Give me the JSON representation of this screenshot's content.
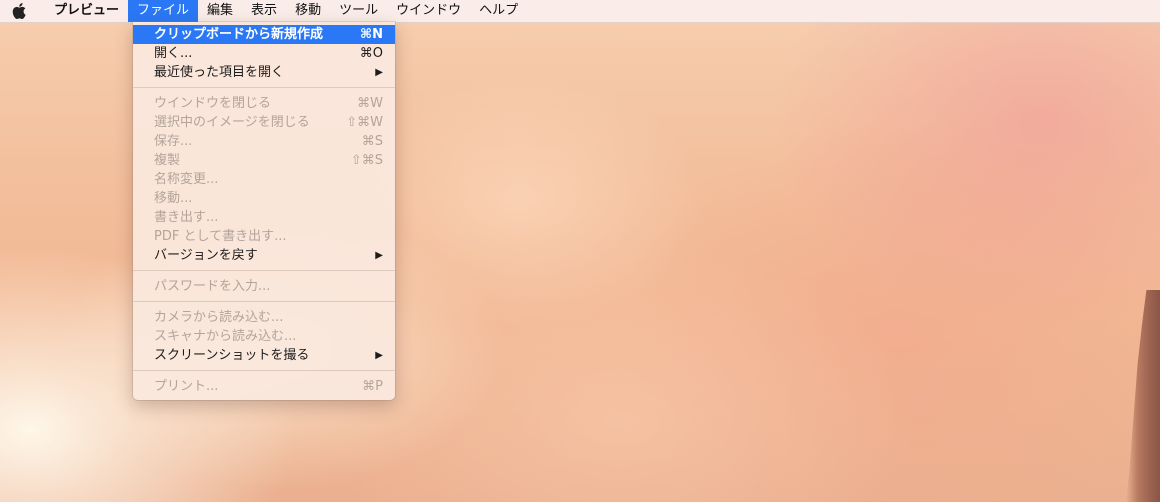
{
  "menubar": {
    "apple_icon": "apple-logo-icon",
    "app_name": "プレビュー",
    "items": [
      {
        "label": "ファイル",
        "active": true
      },
      {
        "label": "編集"
      },
      {
        "label": "表示"
      },
      {
        "label": "移動"
      },
      {
        "label": "ツール"
      },
      {
        "label": "ウインドウ"
      },
      {
        "label": "ヘルプ"
      }
    ]
  },
  "file_menu": {
    "items": [
      {
        "label": "クリップボードから新規作成",
        "shortcut": "⌘N",
        "state": "highlighted"
      },
      {
        "label": "開く...",
        "shortcut": "⌘O"
      },
      {
        "label": "最近使った項目を開く",
        "submenu_arrow": "▶"
      },
      {
        "label": "ウインドウを閉じる",
        "shortcut": "⌘W",
        "state": "disabled"
      },
      {
        "label": "選択中のイメージを閉じる",
        "shortcut": "⇧⌘W",
        "state": "disabled"
      },
      {
        "label": "保存...",
        "shortcut": "⌘S",
        "state": "disabled"
      },
      {
        "label": "複製",
        "shortcut": "⇧⌘S",
        "state": "disabled"
      },
      {
        "label": "名称変更...",
        "state": "disabled"
      },
      {
        "label": "移動...",
        "state": "disabled"
      },
      {
        "label": "書き出す...",
        "state": "disabled"
      },
      {
        "label": "PDF として書き出す...",
        "state": "disabled"
      },
      {
        "label": "バージョンを戻す",
        "submenu_arrow": "▶"
      },
      {
        "label": "パスワードを入力...",
        "state": "disabled"
      },
      {
        "label": "カメラから読み込む...",
        "state": "disabled"
      },
      {
        "label": "スキャナから読み込む...",
        "state": "disabled"
      },
      {
        "label": "スクリーンショットを撮る",
        "submenu_arrow": "▶"
      },
      {
        "label": "プリント...",
        "shortcut": "⌘P",
        "state": "disabled"
      }
    ]
  },
  "colors": {
    "highlight": "#2a78f5",
    "disabled_text": "#b3a49c",
    "menu_background": "#fae8de"
  }
}
